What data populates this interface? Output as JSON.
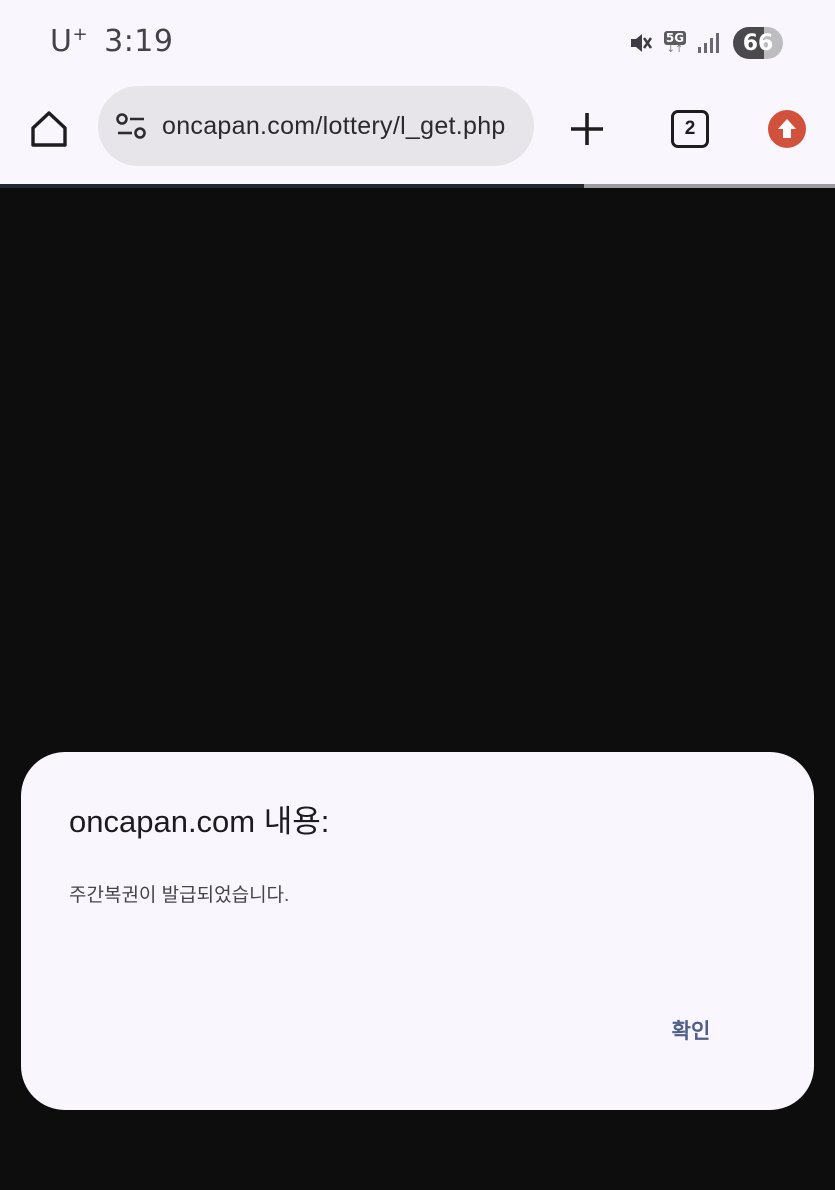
{
  "status_bar": {
    "carrier": "U",
    "carrier_plus": "+",
    "time": "3:19",
    "network": "5G",
    "battery": "66",
    "icons": [
      "mute-icon",
      "5g-data-icon",
      "signal-icon",
      "battery-icon"
    ]
  },
  "toolbar": {
    "url": "oncapan.com/lottery/l_get.php",
    "tab_count": "2",
    "icons": [
      "home-icon",
      "tune-icon",
      "plus-icon",
      "tabs-icon",
      "update-icon"
    ],
    "update_color": "#d2513c"
  },
  "dialog": {
    "title": "oncapan.com 내용:",
    "message": "주간복권이 발급되었습니다.",
    "ok_label": "확인",
    "ok_color": "#4f5f86"
  },
  "page": {
    "background": "#0d0d0e"
  }
}
